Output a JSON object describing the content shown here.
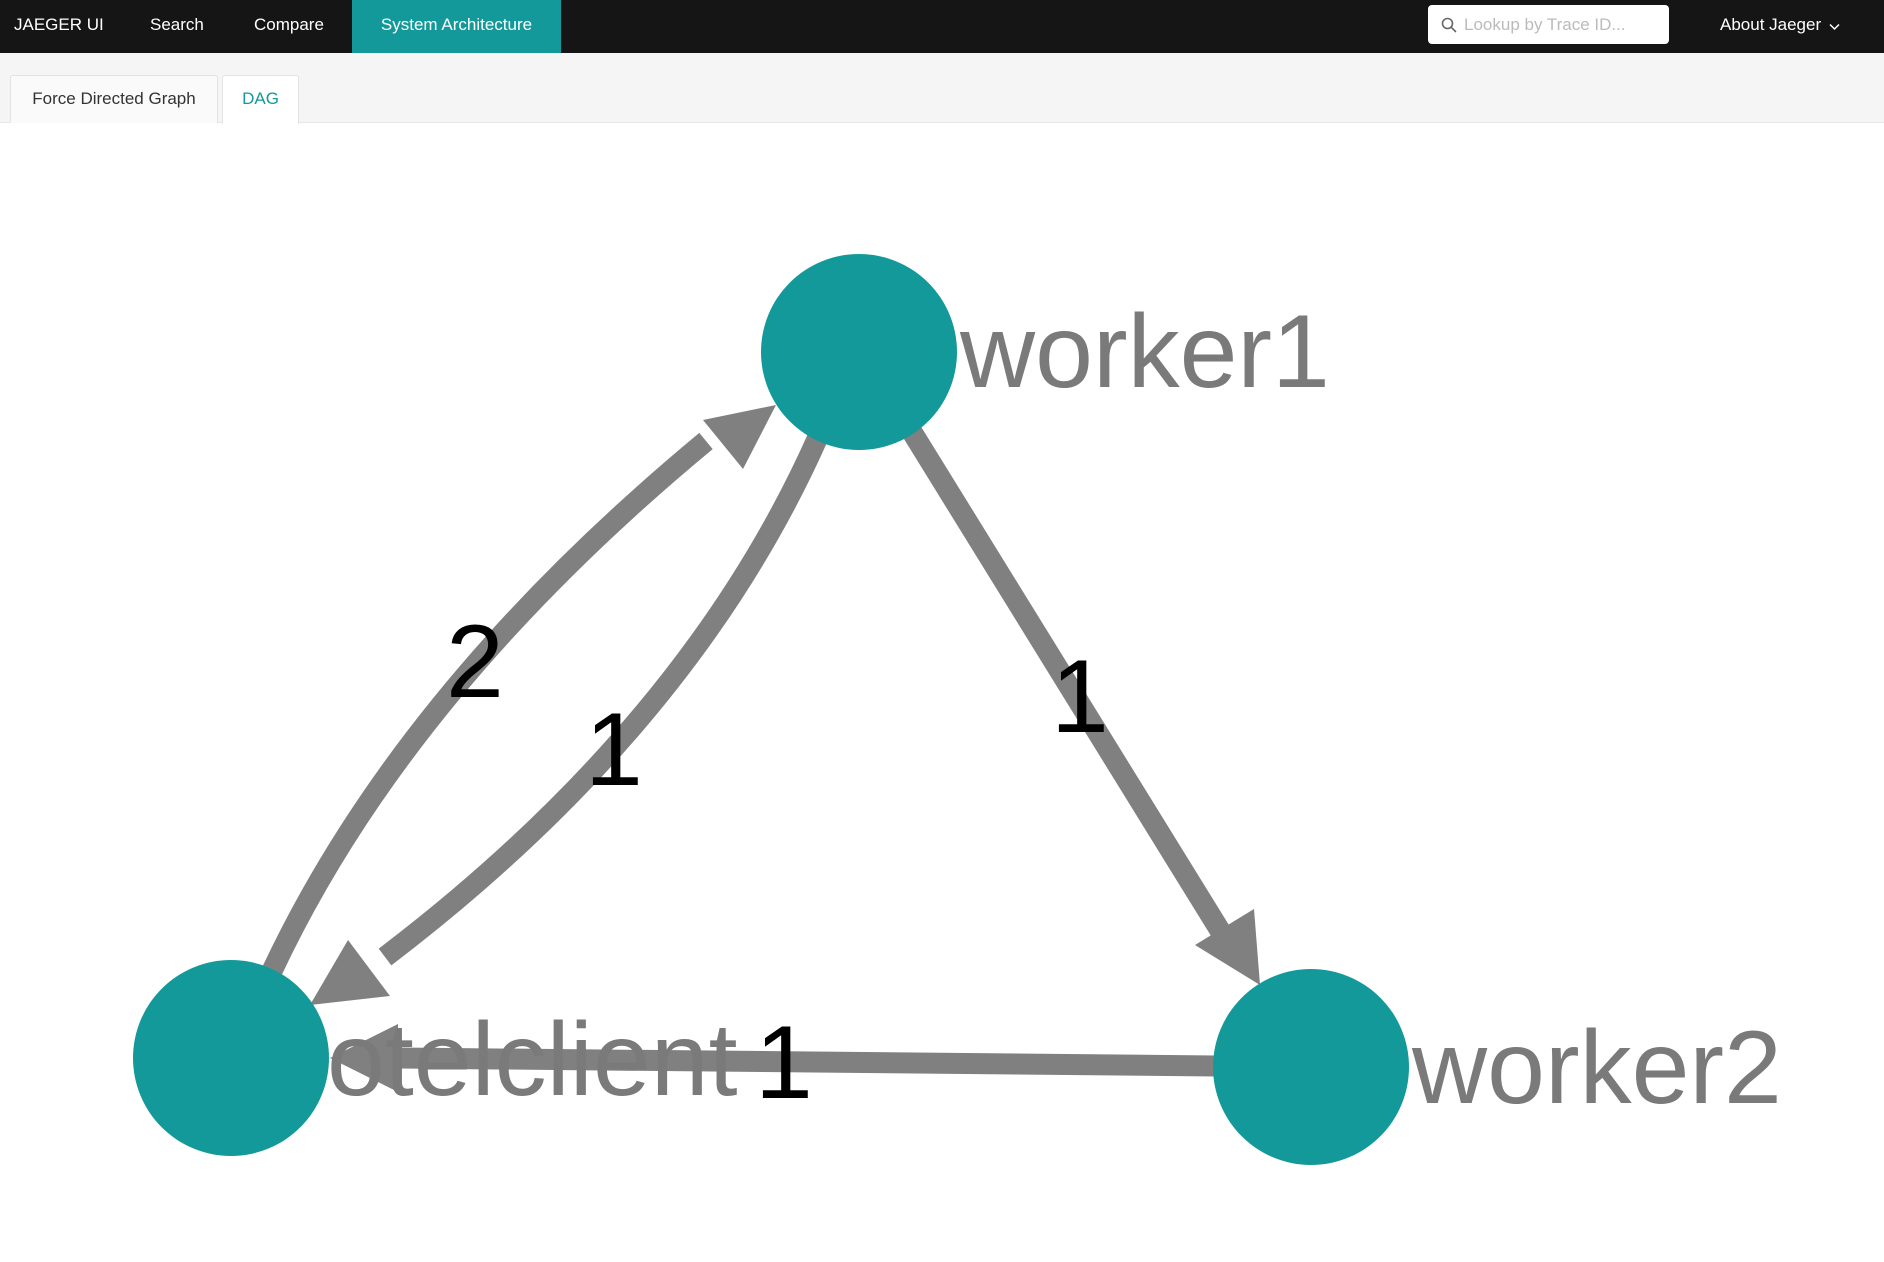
{
  "nav": {
    "brand": "JAEGER UI",
    "items": [
      {
        "label": "Search",
        "active": false
      },
      {
        "label": "Compare",
        "active": false
      },
      {
        "label": "System Architecture",
        "active": true
      }
    ],
    "lookup_placeholder": "Lookup by Trace ID...",
    "about_label": "About Jaeger",
    "search_icon": "search-icon",
    "about_icon": "chevron-down-icon"
  },
  "tabs": [
    {
      "label": "Force Directed Graph",
      "active": false
    },
    {
      "label": "DAG",
      "active": true
    }
  ],
  "graph": {
    "colors": {
      "node": "#139999",
      "edge": "#808080",
      "node_label": "#7a7a7a",
      "edge_label": "#000000",
      "accent": "#139999",
      "topbar": "#151515"
    },
    "nodes": [
      {
        "id": "worker1",
        "label": "worker1"
      },
      {
        "id": "otelclient",
        "label": "otelclient"
      },
      {
        "id": "worker2",
        "label": "worker2"
      }
    ],
    "edges": [
      {
        "from": "otelclient",
        "to": "worker1",
        "count": "2"
      },
      {
        "from": "worker1",
        "to": "otelclient",
        "count": "1"
      },
      {
        "from": "worker1",
        "to": "worker2",
        "count": "1"
      },
      {
        "from": "worker2",
        "to": "otelclient",
        "count": "1"
      }
    ]
  }
}
